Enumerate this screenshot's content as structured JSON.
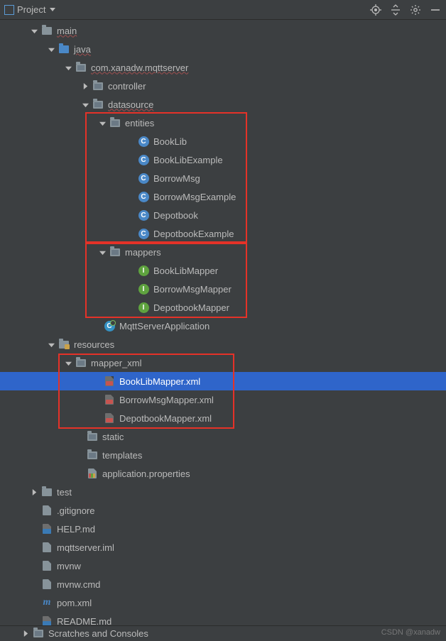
{
  "toolbar": {
    "title": "Project"
  },
  "tree": {
    "main": "main",
    "java": "java",
    "pkg": "com.xanadw.mqttserver",
    "controller": "controller",
    "datasource": "datasource",
    "entities": "entities",
    "ent_items": [
      "BookLib",
      "BookLibExample",
      "BorrowMsg",
      "BorrowMsgExample",
      "Depotbook",
      "DepotbookExample"
    ],
    "mappers": "mappers",
    "map_items": [
      "BookLibMapper",
      "BorrowMsgMapper",
      "DepotbookMapper"
    ],
    "mqtt_app": "MqttServerApplication",
    "resources": "resources",
    "mapper_xml": "mapper_xml",
    "xml_items": [
      "BookLibMapper.xml",
      "BorrowMsgMapper.xml",
      "DepotbookMapper.xml"
    ],
    "static": "static",
    "templates": "templates",
    "app_props": "application.properties",
    "test": "test",
    "gitignore": ".gitignore",
    "help_md": "HELP.md",
    "iml": "mqttserver.iml",
    "mvnw": "mvnw",
    "mvnw_cmd": "mvnw.cmd",
    "pom": "pom.xml",
    "readme": "README.md"
  },
  "bottom": "Scratches and Consoles",
  "watermark": "CSDN @xanadw"
}
